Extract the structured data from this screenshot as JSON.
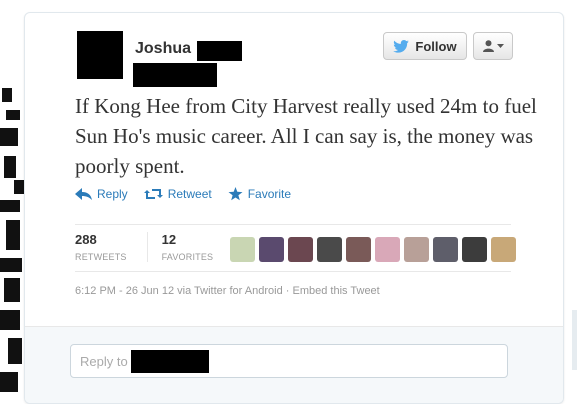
{
  "tweet": {
    "user_name": "Joshua",
    "follow_label": "Follow",
    "text": "If Kong Hee from City Harvest really used 24m to fuel Sun Ho's music career. All I can say is, the money was poorly spent.",
    "actions": {
      "reply": "Reply",
      "retweet": "Retweet",
      "favorite": "Favorite"
    },
    "stats": {
      "retweets_count": "288",
      "retweets_label": "RETWEETS",
      "favorites_count": "12",
      "favorites_label": "FAVORITES"
    },
    "favoriter_avatars": [
      {
        "color": "#c9d6b3"
      },
      {
        "color": "#5a4a6e"
      },
      {
        "color": "#6b4750"
      },
      {
        "color": "#4a4a4a"
      },
      {
        "color": "#7a5a58"
      },
      {
        "color": "#d9a8b8"
      },
      {
        "color": "#b8a098"
      },
      {
        "color": "#5e5e6a"
      },
      {
        "color": "#3c3c3c"
      },
      {
        "color": "#c8a878"
      }
    ],
    "timestamp": "6:12 PM - 26 Jun 12",
    "via_text": "via Twitter for Android",
    "embed_label": "Embed this Tweet"
  },
  "reply": {
    "placeholder_prefix": "Reply to"
  },
  "colors": {
    "link_blue": "#2b7bb9",
    "twitter_bird": "#55acee"
  }
}
